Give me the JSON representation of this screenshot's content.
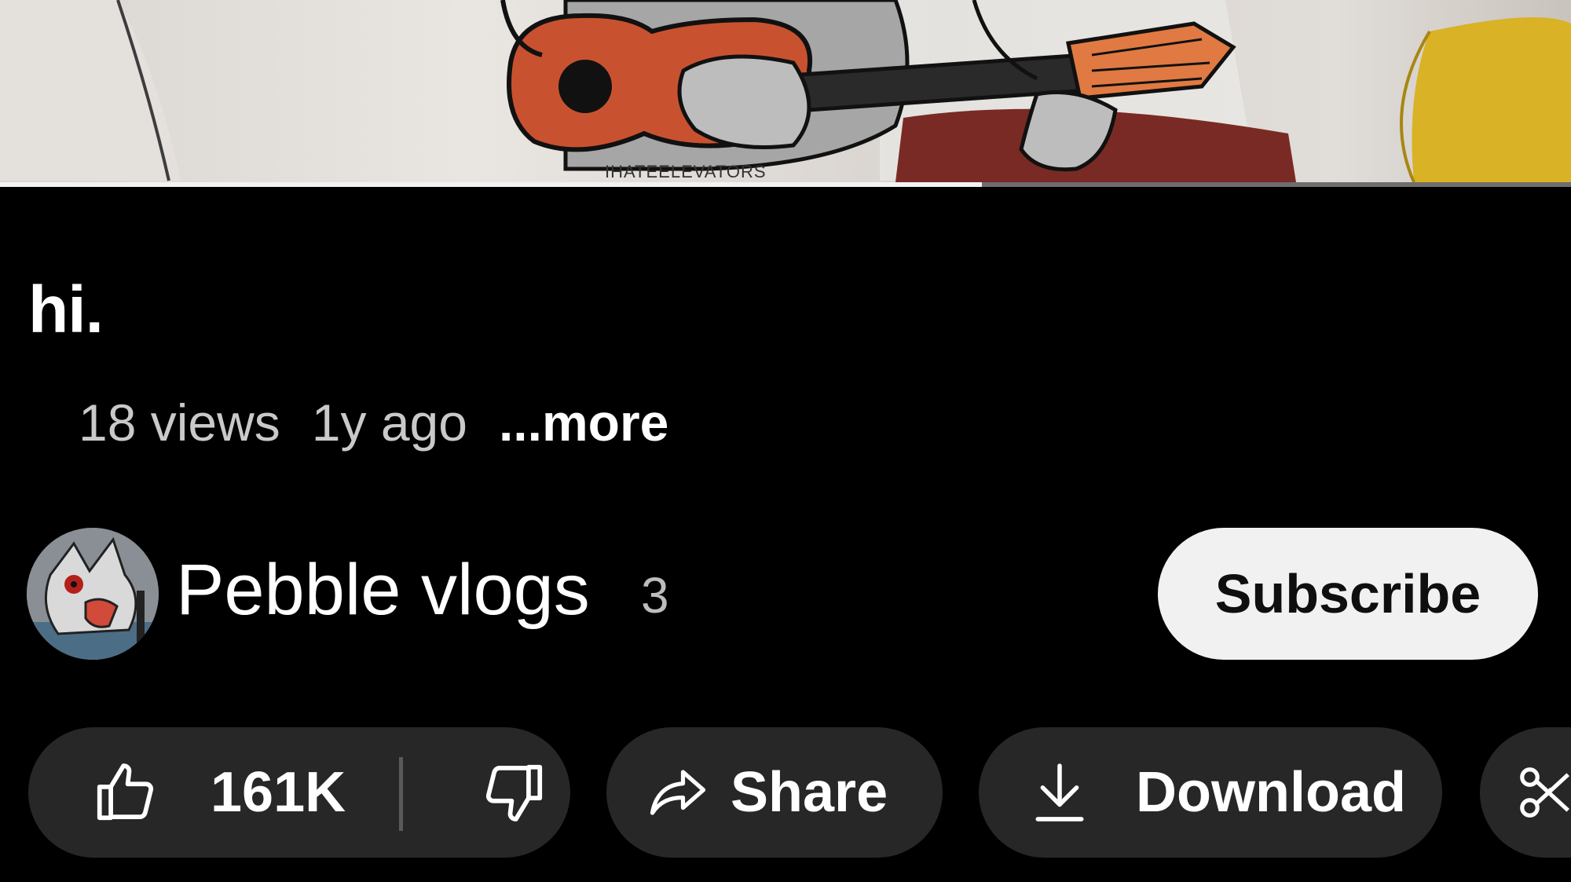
{
  "video": {
    "watermark": "IHATEELEVATORS",
    "progress_fraction": 0.625
  },
  "title": "hi.",
  "meta": {
    "views": "18 views",
    "age": "1y ago",
    "more_label": "...more"
  },
  "channel": {
    "name": "Pebble vlogs",
    "subscriber_count": "3",
    "subscribe_label": "Subscribe"
  },
  "actions": {
    "like_count": "161K",
    "share_label": "Share",
    "download_label": "Download"
  },
  "icons": {
    "like": "thumbs-up-icon",
    "dislike": "thumbs-down-icon",
    "share": "share-arrow-icon",
    "download": "download-icon",
    "clip": "scissors-icon"
  },
  "colors": {
    "background": "#000000",
    "pill": "#272727",
    "subscribe_bg": "#f1f1f1",
    "progress_played": "#f2f2f2",
    "progress_unplayed": "#6e6e6e"
  }
}
